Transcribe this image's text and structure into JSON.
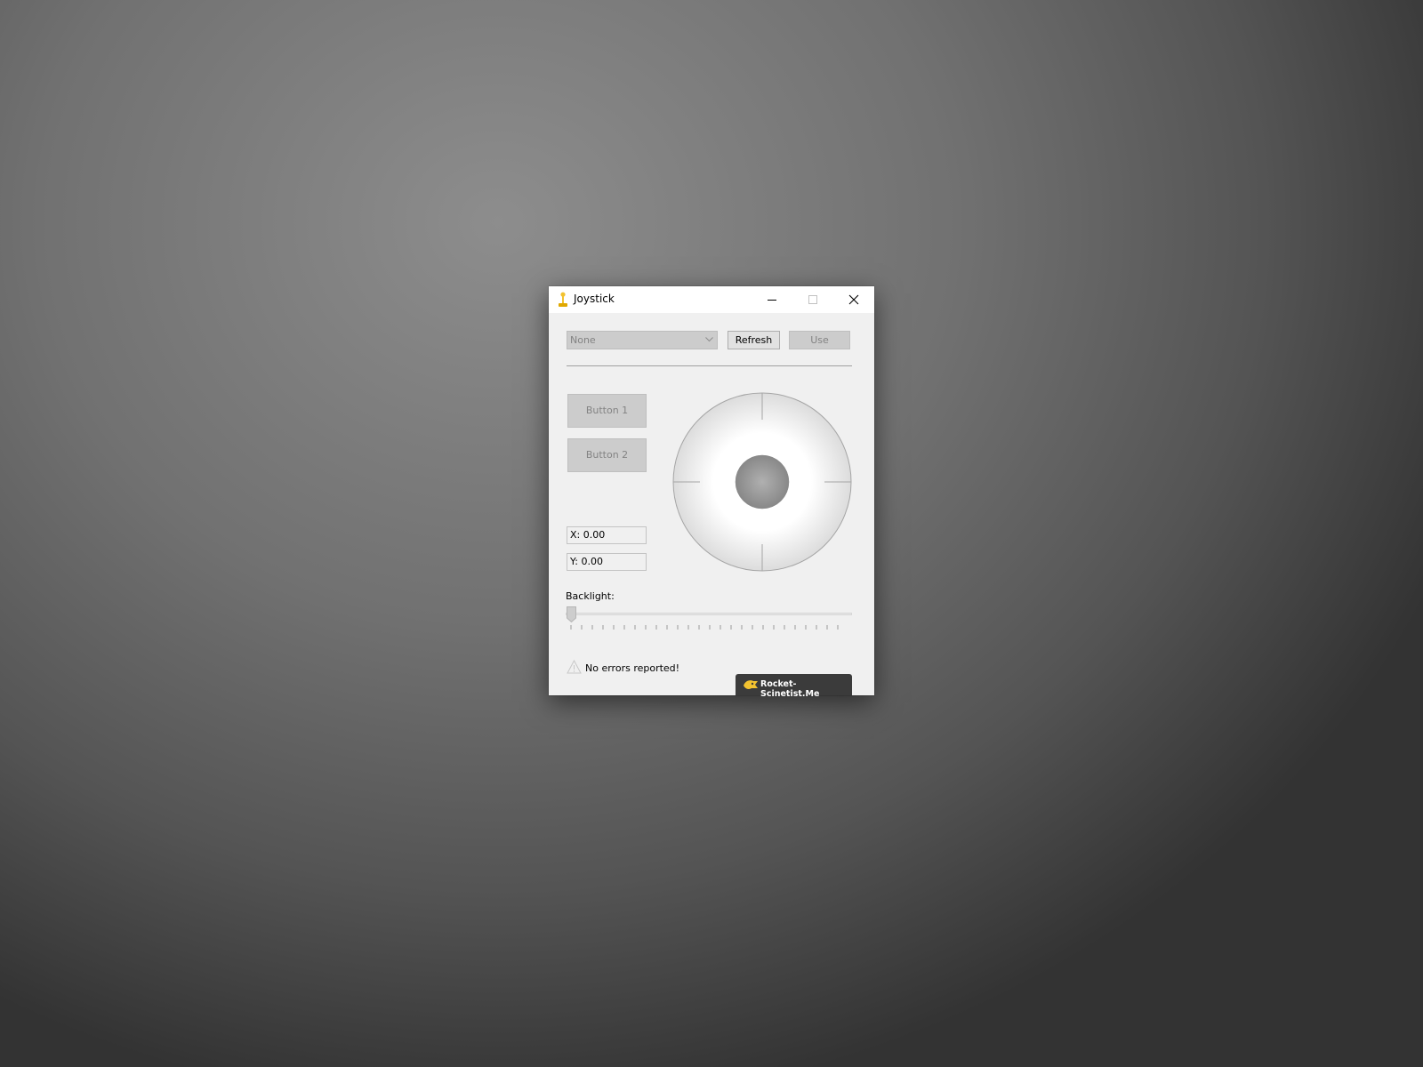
{
  "window": {
    "title": "Joystick",
    "icon": "joystick-icon",
    "controls": {
      "minimize": "minimize-icon",
      "maximize": "maximize-icon",
      "close": "close-icon"
    }
  },
  "device_selector": {
    "selected": "None",
    "refresh_label": "Refresh",
    "use_label": "Use"
  },
  "buttons": {
    "button1_label": "Button 1",
    "button2_label": "Button 2"
  },
  "coordinates": {
    "x_text": "X: 0.00",
    "y_text": "Y: 0.00",
    "x": 0.0,
    "y": 0.0
  },
  "backlight": {
    "label": "Backlight:",
    "value": 0,
    "min": 0,
    "max": 25
  },
  "status": {
    "icon": "warning-icon",
    "message": "No errors reported!"
  },
  "branding": {
    "icon": "rocket-icon",
    "text": "Rocket-Scinetist.Me"
  },
  "colors": {
    "accent": "#f2c230",
    "badge_bg": "#3b3b3b",
    "disabled_bg": "#cccccc",
    "disabled_text": "#838383"
  }
}
